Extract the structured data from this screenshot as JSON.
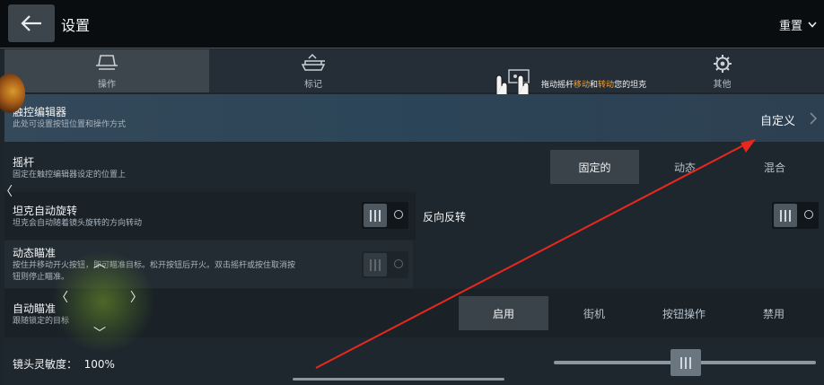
{
  "header": {
    "title": "设置",
    "reset_label": "重置"
  },
  "tabs": [
    {
      "label": "操作",
      "icon": "tank-control-icon",
      "active": true
    },
    {
      "label": "标记",
      "icon": "tank-marker-icon",
      "active": false
    },
    {
      "label": "",
      "icon": "touch-device-icon",
      "active": false
    },
    {
      "label": "其他",
      "icon": "gear-icon",
      "active": false
    }
  ],
  "hint": {
    "text_a": "拖动摇杆",
    "text_b": "移动",
    "text_c": "和",
    "text_d": "转动",
    "text_e": "您的坦克"
  },
  "touch_editor": {
    "title": "触控编辑器",
    "subtitle": "此处可设置按钮位置和操作方式",
    "action": "自定义"
  },
  "joystick_setting": {
    "title": "摇杆",
    "subtitle": "固定在触控编辑器设定的位置上",
    "options": [
      "固定的",
      "动态",
      "混合"
    ],
    "selected": "固定的"
  },
  "auto_rotate": {
    "title": "坦克自动旋转",
    "subtitle": "坦克会自动随着镜头旋转的方向转动",
    "enabled": true
  },
  "reverse": {
    "title": "反向反转",
    "enabled": true
  },
  "dynamic_aim": {
    "title": "动态瞄准",
    "subtitle_1": "按住并移动开火按钮，即可瞄准目标。松开按钮后开火。双击摇杆或按住取消按",
    "subtitle_2": "钮则停止瞄准。",
    "enabled": false
  },
  "auto_aim": {
    "title": "自动瞄准",
    "subtitle": "跟随锁定的目标",
    "options": [
      "启用",
      "街机",
      "按钮操作",
      "禁用"
    ],
    "selected": "启用"
  },
  "camera_sensitivity": {
    "label": "镜头灵敏度：",
    "value": "100%",
    "level": 0.45
  },
  "colors": {
    "accent": "#f2a33a",
    "annotation_arrow": "#e8281e",
    "background": "#1e262d"
  }
}
